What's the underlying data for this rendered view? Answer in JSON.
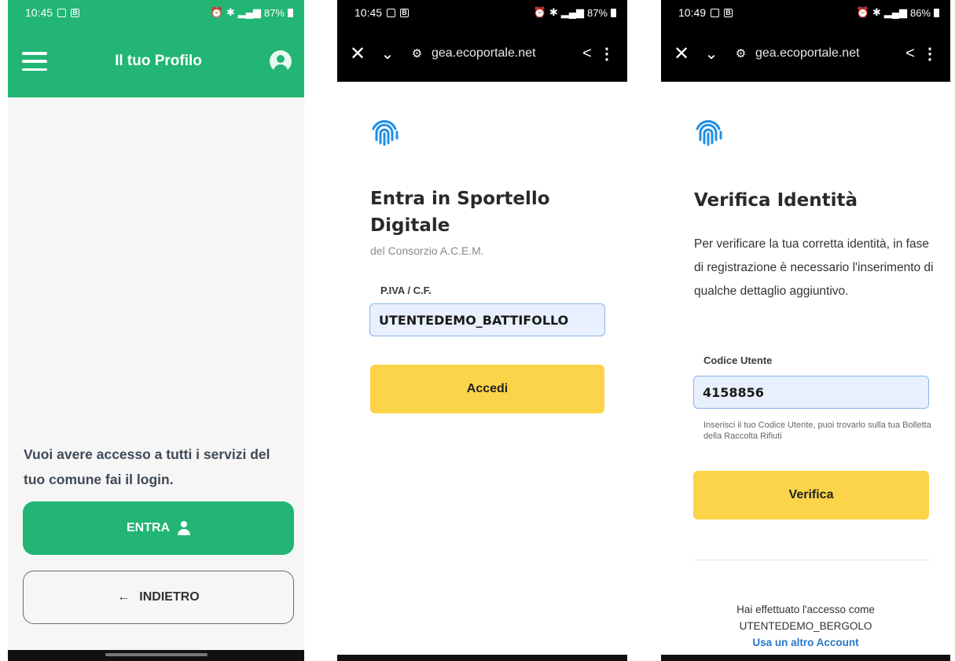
{
  "screen1": {
    "status": {
      "time": "10:45",
      "battery": "87%"
    },
    "header": {
      "title": "Il tuo Profilo"
    },
    "prompt": "Vuoi avere accesso a tutti i servizi del tuo comune fai il login.",
    "enter_button": "ENTRA",
    "back_button": "INDIETRO",
    "colors": {
      "brand": "#22b573"
    }
  },
  "screen2": {
    "status": {
      "time": "10:45",
      "battery": "87%"
    },
    "browser": {
      "url": "gea.ecoportale.net"
    },
    "title_line1": "Entra in Sportello",
    "title_line2": "Digitale",
    "subtitle": "del Consorzio A.C.E.M.",
    "field_label": "P.IVA / C.F.",
    "field_value": "UTENTEDEMO_BATTIFOLLO",
    "login_button": "Accedi",
    "colors": {
      "accent": "#fbd44a"
    }
  },
  "screen3": {
    "status": {
      "time": "10:49",
      "battery": "86%"
    },
    "browser": {
      "url": "gea.ecoportale.net"
    },
    "title": "Verifica Identità",
    "description": "Per verificare la tua corretta identità, in fase di registrazione è necessario l'inserimento di qualche dettaglio aggiuntivo.",
    "field_label": "Codice Utente",
    "field_value": "4158856",
    "hint": "Inserisci il tuo Codice Utente, puoi trovarlo sulla tua Bolletta della Raccolta Rifiuti",
    "verify_button": "Verifica",
    "logged_as_label": "Hai effettuato l'accesso come",
    "logged_user": "UTENTEDEMO_BERGOLO",
    "switch_account_link": "Usa un altro Account"
  }
}
